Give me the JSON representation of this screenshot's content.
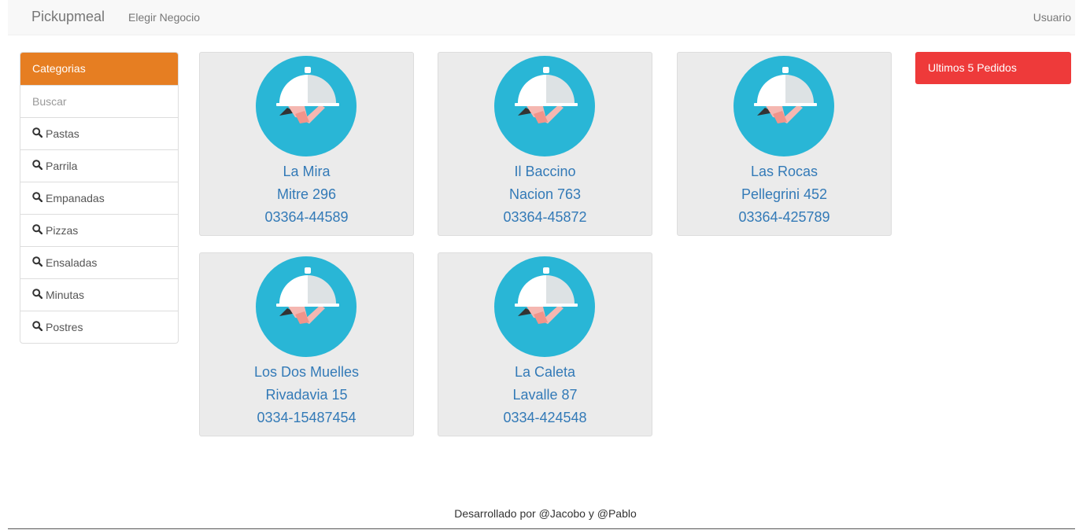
{
  "navbar": {
    "brand": "Pickupmeal",
    "link": "Elegir Negocio",
    "user": "Usuario"
  },
  "sidebar": {
    "heading": "Categorias",
    "search_placeholder": "Buscar",
    "items": [
      {
        "label": "Pastas"
      },
      {
        "label": "Parrila"
      },
      {
        "label": "Empanadas"
      },
      {
        "label": "Pizzas"
      },
      {
        "label": "Ensaladas"
      },
      {
        "label": "Minutas"
      },
      {
        "label": "Postres"
      }
    ]
  },
  "businesses": [
    {
      "name": "La Mira",
      "address": "Mitre 296",
      "phone": "03364-44589"
    },
    {
      "name": "Il Baccino",
      "address": "Nacion 763",
      "phone": "03364-45872"
    },
    {
      "name": "Las Rocas",
      "address": "Pellegrini 452",
      "phone": "03364-425789"
    },
    {
      "name": "Los Dos Muelles",
      "address": "Rivadavia 15",
      "phone": "0334-15487454"
    },
    {
      "name": "La Caleta",
      "address": "Lavalle 87",
      "phone": "0334-424548"
    }
  ],
  "orders_panel": {
    "label": "Ultimos 5 Pedidos"
  },
  "footer": {
    "text": "Desarrollado por @Jacobo y @Pablo"
  },
  "colors": {
    "categories_header": "#e67e22",
    "orders_header": "#ee3a3a",
    "logo_circle": "#29b6d6",
    "link_text": "#337ab7"
  }
}
